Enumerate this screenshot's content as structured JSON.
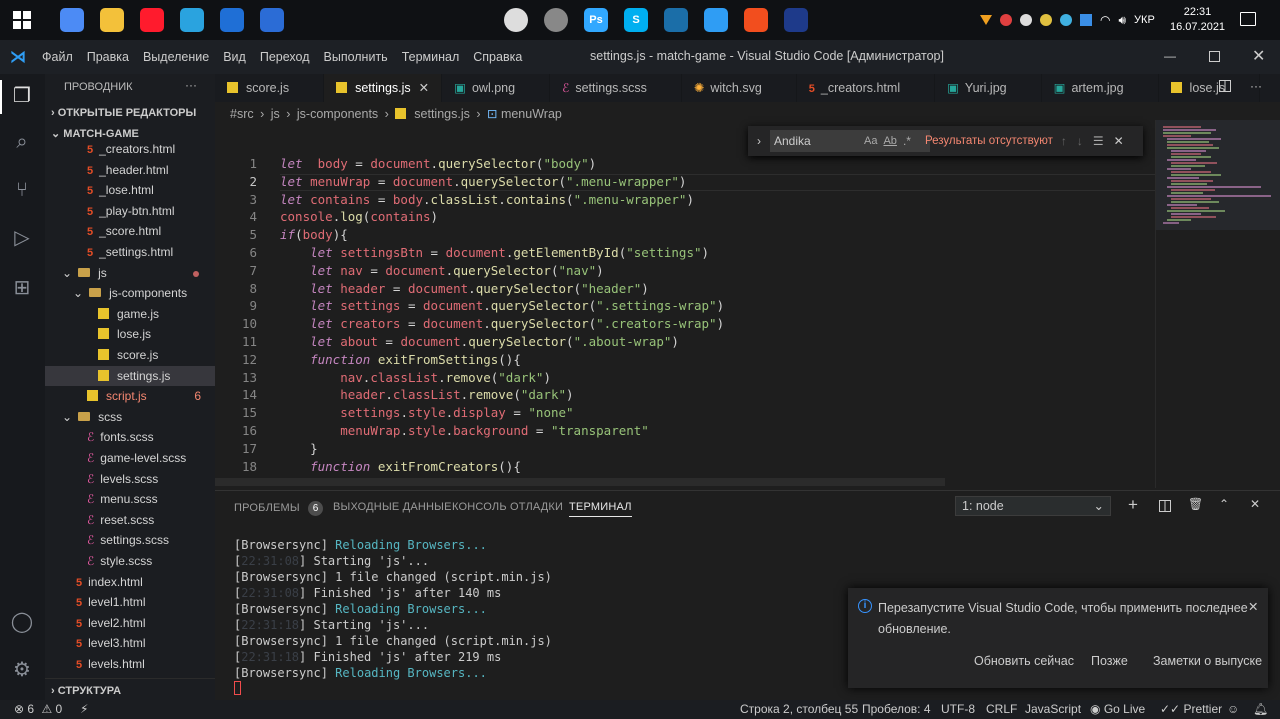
{
  "taskbar": {
    "icons": [
      {
        "name": "windows-start-icon",
        "color": "#ffffff"
      },
      {
        "name": "chrome-icon",
        "color": "#4c8bf5"
      },
      {
        "name": "file-explorer-icon",
        "color": "#f3c13a"
      },
      {
        "name": "opera-icon",
        "color": "#ff1b2d"
      },
      {
        "name": "telegram-icon",
        "color": "#2aa3df"
      },
      {
        "name": "store-icon",
        "color": "#1f6fd6"
      },
      {
        "name": "media-icon",
        "color": "#2b6cd6"
      },
      {
        "name": "assassins-creed-icon",
        "color": "#dddddd"
      },
      {
        "name": "steam-disc-icon",
        "color": "#888888"
      },
      {
        "name": "photoshop-icon",
        "color": "#31a8ff",
        "label": "Ps"
      },
      {
        "name": "skype-icon",
        "color": "#00aff0",
        "label": "S"
      },
      {
        "name": "steam-icon",
        "color": "#1b6ea8"
      },
      {
        "name": "vscode-icon",
        "color": "#2f9df4"
      },
      {
        "name": "figma-icon",
        "color": "#f24e1e"
      },
      {
        "name": "cinema4d-icon",
        "color": "#1e3a8a"
      }
    ],
    "lang": "УКР",
    "time": "22:31",
    "date": "16.07.2021"
  },
  "titlebar": {
    "menu": [
      "Файл",
      "Правка",
      "Выделение",
      "Вид",
      "Переход",
      "Выполнить",
      "Терминал",
      "Справка"
    ],
    "title": "settings.js - match-game - Visual Studio Code [Администратор]"
  },
  "sidebar": {
    "header": "ПРОВОДНИК",
    "open_editors": "ОТКРЫТЫЕ РЕДАКТОРЫ",
    "project": "MATCH-GAME",
    "structure": "СТРУКТУРА",
    "files": [
      {
        "label": "_creators.html",
        "type": "html",
        "indent": 2
      },
      {
        "label": "_header.html",
        "type": "html",
        "indent": 2
      },
      {
        "label": "_lose.html",
        "type": "html",
        "indent": 2
      },
      {
        "label": "_play-btn.html",
        "type": "html",
        "indent": 2
      },
      {
        "label": "_score.html",
        "type": "html",
        "indent": 2
      },
      {
        "label": "_settings.html",
        "type": "html",
        "indent": 2
      },
      {
        "label": "js",
        "type": "folder",
        "indent": 1
      },
      {
        "label": "js-components",
        "type": "folder",
        "indent": 2
      },
      {
        "label": "game.js",
        "type": "js",
        "indent": 3
      },
      {
        "label": "lose.js",
        "type": "js",
        "indent": 3
      },
      {
        "label": "score.js",
        "type": "js",
        "indent": 3
      },
      {
        "label": "settings.js",
        "type": "js",
        "indent": 3
      },
      {
        "label": "script.js",
        "type": "js",
        "indent": 2,
        "badge": "6"
      },
      {
        "label": "scss",
        "type": "folder",
        "indent": 1
      },
      {
        "label": "fonts.scss",
        "type": "scss",
        "indent": 2
      },
      {
        "label": "game-level.scss",
        "type": "scss",
        "indent": 2
      },
      {
        "label": "levels.scss",
        "type": "scss",
        "indent": 2
      },
      {
        "label": "menu.scss",
        "type": "scss",
        "indent": 2
      },
      {
        "label": "reset.scss",
        "type": "scss",
        "indent": 2
      },
      {
        "label": "settings.scss",
        "type": "scss",
        "indent": 2
      },
      {
        "label": "style.scss",
        "type": "scss",
        "indent": 2
      },
      {
        "label": "index.html",
        "type": "html",
        "indent": 1
      },
      {
        "label": "level1.html",
        "type": "html",
        "indent": 1
      },
      {
        "label": "level2.html",
        "type": "html",
        "indent": 1
      },
      {
        "label": "level3.html",
        "type": "html",
        "indent": 1
      },
      {
        "label": "levels.html",
        "type": "html",
        "indent": 1
      }
    ]
  },
  "tabs": [
    {
      "label": "score.js",
      "type": "js"
    },
    {
      "label": "settings.js",
      "type": "js",
      "active": true
    },
    {
      "label": "owl.png",
      "type": "img"
    },
    {
      "label": "settings.scss",
      "type": "scss"
    },
    {
      "label": "witch.svg",
      "type": "svg"
    },
    {
      "label": "_creators.html",
      "type": "html"
    },
    {
      "label": "Yuri.jpg",
      "type": "img"
    },
    {
      "label": "artem.jpg",
      "type": "img"
    },
    {
      "label": "lose.js",
      "type": "js"
    }
  ],
  "breadcrumb": [
    "#src",
    "js",
    "js-components",
    "settings.js",
    "menuWrap"
  ],
  "find": {
    "value": "Andika",
    "result": "Результаты отсутствуют"
  },
  "code": [
    [
      [
        "kw",
        "let"
      ],
      [
        "",
        "  "
      ],
      [
        "vr",
        "body"
      ],
      [
        "",
        " = "
      ],
      [
        "vr",
        "document"
      ],
      [
        "",
        "."
      ],
      [
        "fn",
        "querySelector"
      ],
      [
        "",
        "("
      ],
      [
        "st",
        "\"body\""
      ],
      [
        "",
        ")"
      ]
    ],
    [
      [
        "kw",
        "let"
      ],
      [
        "",
        " "
      ],
      [
        "vr",
        "menuWrap"
      ],
      [
        "",
        " = "
      ],
      [
        "vr",
        "document"
      ],
      [
        "",
        "."
      ],
      [
        "fn",
        "querySelector"
      ],
      [
        "",
        "("
      ],
      [
        "st",
        "\".menu-wrapper\""
      ],
      [
        "",
        ")"
      ]
    ],
    [
      [
        "kw",
        "let"
      ],
      [
        "",
        " "
      ],
      [
        "vr",
        "contains"
      ],
      [
        "",
        " = "
      ],
      [
        "vr",
        "body"
      ],
      [
        "",
        "."
      ],
      [
        "fn",
        "classList"
      ],
      [
        "",
        "."
      ],
      [
        "fn",
        "contains"
      ],
      [
        "",
        "("
      ],
      [
        "st",
        "\".menu-wrapper\""
      ],
      [
        "",
        ")"
      ]
    ],
    [
      [
        "vr",
        "console"
      ],
      [
        "",
        "."
      ],
      [
        "fn",
        "log"
      ],
      [
        "",
        "("
      ],
      [
        "vr",
        "contains"
      ],
      [
        "",
        ")"
      ]
    ],
    [
      [
        "kw",
        "if"
      ],
      [
        "",
        "("
      ],
      [
        "vr",
        "body"
      ],
      [
        "",
        "){"
      ]
    ],
    [
      [
        "",
        "    "
      ],
      [
        "kw",
        "let"
      ],
      [
        "",
        " "
      ],
      [
        "vr",
        "settingsBtn"
      ],
      [
        "",
        " = "
      ],
      [
        "vr",
        "document"
      ],
      [
        "",
        "."
      ],
      [
        "fn",
        "getElementById"
      ],
      [
        "",
        "("
      ],
      [
        "st",
        "\"settings\""
      ],
      [
        "",
        ")"
      ]
    ],
    [
      [
        "",
        "    "
      ],
      [
        "kw",
        "let"
      ],
      [
        "",
        " "
      ],
      [
        "vr",
        "nav"
      ],
      [
        "",
        " = "
      ],
      [
        "vr",
        "document"
      ],
      [
        "",
        "."
      ],
      [
        "fn",
        "querySelector"
      ],
      [
        "",
        "("
      ],
      [
        "st",
        "\"nav\""
      ],
      [
        "",
        ")"
      ]
    ],
    [
      [
        "",
        "    "
      ],
      [
        "kw",
        "let"
      ],
      [
        "",
        " "
      ],
      [
        "vr",
        "header"
      ],
      [
        "",
        " = "
      ],
      [
        "vr",
        "document"
      ],
      [
        "",
        "."
      ],
      [
        "fn",
        "querySelector"
      ],
      [
        "",
        "("
      ],
      [
        "st",
        "\"header\""
      ],
      [
        "",
        ")"
      ]
    ],
    [
      [
        "",
        "    "
      ],
      [
        "kw",
        "let"
      ],
      [
        "",
        " "
      ],
      [
        "vr",
        "settings"
      ],
      [
        "",
        " = "
      ],
      [
        "vr",
        "document"
      ],
      [
        "",
        "."
      ],
      [
        "fn",
        "querySelector"
      ],
      [
        "",
        "("
      ],
      [
        "st",
        "\".settings-wrap\""
      ],
      [
        "",
        ")"
      ]
    ],
    [
      [
        "",
        "    "
      ],
      [
        "kw",
        "let"
      ],
      [
        "",
        " "
      ],
      [
        "vr",
        "creators"
      ],
      [
        "",
        " = "
      ],
      [
        "vr",
        "document"
      ],
      [
        "",
        "."
      ],
      [
        "fn",
        "querySelector"
      ],
      [
        "",
        "("
      ],
      [
        "st",
        "\".creators-wrap\""
      ],
      [
        "",
        ")"
      ]
    ],
    [
      [
        "",
        "    "
      ],
      [
        "kw",
        "let"
      ],
      [
        "",
        " "
      ],
      [
        "vr",
        "about"
      ],
      [
        "",
        " = "
      ],
      [
        "vr",
        "document"
      ],
      [
        "",
        "."
      ],
      [
        "fn",
        "querySelector"
      ],
      [
        "",
        "("
      ],
      [
        "st",
        "\".about-wrap\""
      ],
      [
        "",
        ")"
      ]
    ],
    [
      [
        "",
        "    "
      ],
      [
        "kw",
        "function"
      ],
      [
        "",
        " "
      ],
      [
        "fn",
        "exitFromSettings"
      ],
      [
        "",
        "(){"
      ]
    ],
    [
      [
        "",
        "        "
      ],
      [
        "vr",
        "nav"
      ],
      [
        "",
        "."
      ],
      [
        "vr",
        "classList"
      ],
      [
        "",
        "."
      ],
      [
        "fn",
        "remove"
      ],
      [
        "",
        "("
      ],
      [
        "st",
        "\"dark\""
      ],
      [
        "",
        ")"
      ]
    ],
    [
      [
        "",
        "        "
      ],
      [
        "vr",
        "header"
      ],
      [
        "",
        "."
      ],
      [
        "vr",
        "classList"
      ],
      [
        "",
        "."
      ],
      [
        "fn",
        "remove"
      ],
      [
        "",
        "("
      ],
      [
        "st",
        "\"dark\""
      ],
      [
        "",
        ")"
      ]
    ],
    [
      [
        "",
        "        "
      ],
      [
        "vr",
        "settings"
      ],
      [
        "",
        "."
      ],
      [
        "vr",
        "style"
      ],
      [
        "",
        "."
      ],
      [
        "vr",
        "display"
      ],
      [
        "",
        " = "
      ],
      [
        "st",
        "\"none\""
      ]
    ],
    [
      [
        "",
        "        "
      ],
      [
        "vr",
        "menuWrap"
      ],
      [
        "",
        "."
      ],
      [
        "vr",
        "style"
      ],
      [
        "",
        "."
      ],
      [
        "vr",
        "background"
      ],
      [
        "",
        " = "
      ],
      [
        "st",
        "\"transparent\""
      ]
    ],
    [
      [
        "",
        "    }"
      ]
    ],
    [
      [
        "",
        "    "
      ],
      [
        "kw",
        "function"
      ],
      [
        "",
        " "
      ],
      [
        "fn",
        "exitFromCreators"
      ],
      [
        "",
        "(){"
      ]
    ]
  ],
  "panel": {
    "tabs": [
      "ПРОБЛЕМЫ",
      "ВЫХОДНЫЕ ДАННЫЕ",
      "КОНСОЛЬ ОТЛАДКИ",
      "ТЕРМИНАЛ"
    ],
    "problems_count": "6",
    "terminal_select": "1: node",
    "lines": [
      {
        "pre": "[",
        "tag": "Browsersync",
        "post": "] ",
        "msg": "Reloading Browsers...",
        "msgc": "cy"
      },
      {
        "pre": "[",
        "tag": "22:31:08",
        "tagc": "gy",
        "post": "] ",
        "msg": "Starting 'js'...",
        "msgc": ""
      },
      {
        "pre": "[",
        "tag": "Browsersync",
        "post": "] ",
        "msg": "1 file changed (script.min.js)",
        "msgc": ""
      },
      {
        "pre": "[",
        "tag": "22:31:08",
        "tagc": "gy",
        "post": "] ",
        "msg": "Finished 'js' after 140 ms",
        "msgc": ""
      },
      {
        "pre": "[",
        "tag": "Browsersync",
        "post": "] ",
        "msg": "Reloading Browsers...",
        "msgc": "cy"
      },
      {
        "pre": "[",
        "tag": "22:31:18",
        "tagc": "gy",
        "post": "] ",
        "msg": "Starting 'js'...",
        "msgc": ""
      },
      {
        "pre": "[",
        "tag": "Browsersync",
        "post": "] ",
        "msg": "1 file changed (script.min.js)",
        "msgc": ""
      },
      {
        "pre": "[",
        "tag": "22:31:18",
        "tagc": "gy",
        "post": "] ",
        "msg": "Finished 'js' after 219 ms",
        "msgc": ""
      },
      {
        "pre": "[",
        "tag": "Browsersync",
        "post": "] ",
        "msg": "Reloading Browsers...",
        "msgc": "cy"
      }
    ]
  },
  "notification": {
    "text": "Перезапустите Visual Studio Code, чтобы применить последнее обновление.",
    "actions": [
      "Обновить сейчас",
      "Позже",
      "Заметки о выпуске"
    ]
  },
  "status": {
    "errors": "6",
    "warnings": "0",
    "position": "Строка 2, столбец 55",
    "spaces": "Пробелов: 4",
    "encoding": "UTF-8",
    "eol": "CRLF",
    "language": "JavaScript",
    "golive": "Go Live",
    "prettier": "Prettier"
  },
  "colors": {
    "accent": "#0078d4",
    "html": "#e44d26",
    "js": "#e8c32c",
    "scss": "#e0589e",
    "error": "#f14c4c"
  }
}
